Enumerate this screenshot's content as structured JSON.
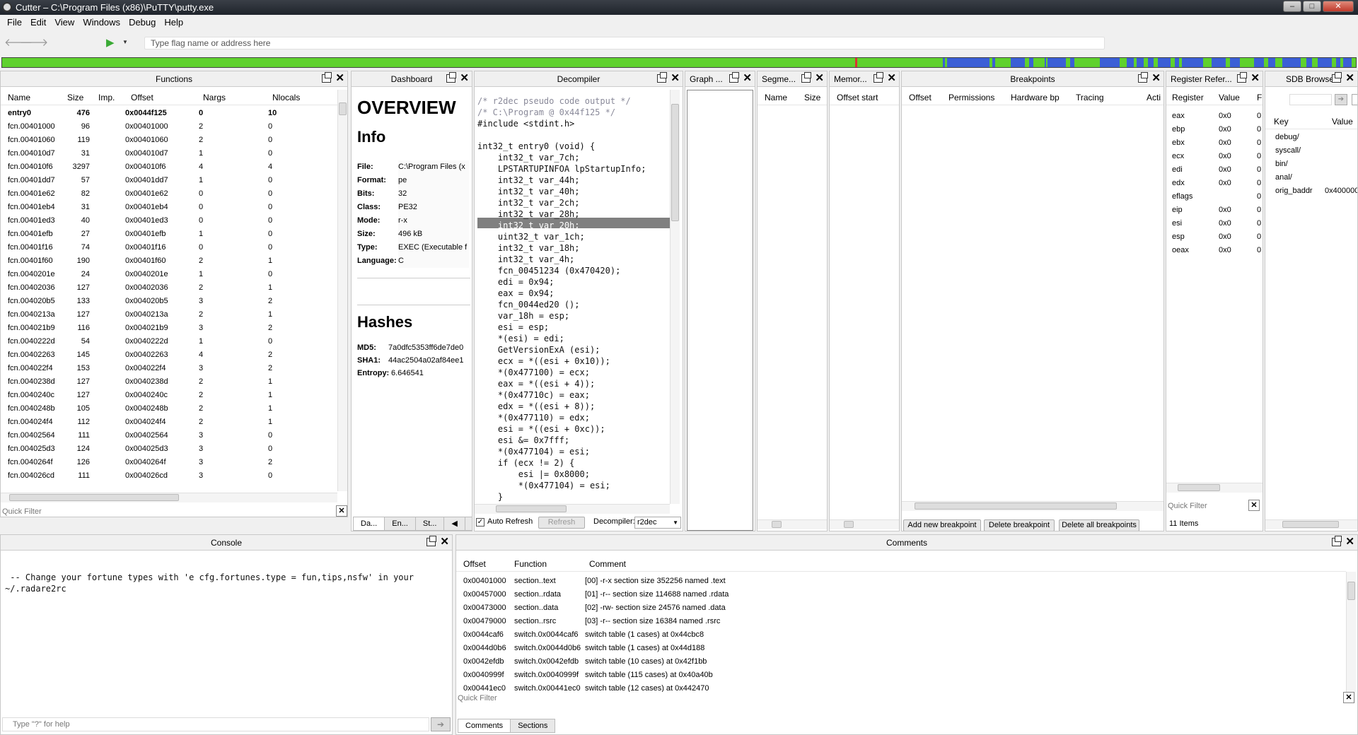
{
  "window": {
    "title": "Cutter – C:\\Program Files (x86)\\PuTTY\\putty.exe"
  },
  "menu": [
    "File",
    "Edit",
    "View",
    "Windows",
    "Debug",
    "Help"
  ],
  "toolbar": {
    "search_placeholder": "Type flag name or address here",
    "back_icon": "arrow-left-icon",
    "forward_icon": "arrow-right-icon",
    "play_icon": "play-icon"
  },
  "functions": {
    "title": "Functions",
    "columns": [
      "Name",
      "Size",
      "Imp.",
      "Offset",
      "Nargs",
      "Nlocals"
    ],
    "rows": [
      [
        "entry0",
        "476",
        "",
        "0x0044f125",
        "0",
        "10"
      ],
      [
        "fcn.00401000",
        "96",
        "",
        "0x00401000",
        "2",
        "0"
      ],
      [
        "fcn.00401060",
        "119",
        "",
        "0x00401060",
        "2",
        "0"
      ],
      [
        "fcn.004010d7",
        "31",
        "",
        "0x004010d7",
        "1",
        "0"
      ],
      [
        "fcn.004010f6",
        "3297",
        "",
        "0x004010f6",
        "4",
        "4"
      ],
      [
        "fcn.00401dd7",
        "57",
        "",
        "0x00401dd7",
        "1",
        "0"
      ],
      [
        "fcn.00401e62",
        "82",
        "",
        "0x00401e62",
        "0",
        "0"
      ],
      [
        "fcn.00401eb4",
        "31",
        "",
        "0x00401eb4",
        "0",
        "0"
      ],
      [
        "fcn.00401ed3",
        "40",
        "",
        "0x00401ed3",
        "0",
        "0"
      ],
      [
        "fcn.00401efb",
        "27",
        "",
        "0x00401efb",
        "1",
        "0"
      ],
      [
        "fcn.00401f16",
        "74",
        "",
        "0x00401f16",
        "0",
        "0"
      ],
      [
        "fcn.00401f60",
        "190",
        "",
        "0x00401f60",
        "2",
        "1"
      ],
      [
        "fcn.0040201e",
        "24",
        "",
        "0x0040201e",
        "1",
        "0"
      ],
      [
        "fcn.00402036",
        "127",
        "",
        "0x00402036",
        "2",
        "1"
      ],
      [
        "fcn.004020b5",
        "133",
        "",
        "0x004020b5",
        "3",
        "2"
      ],
      [
        "fcn.0040213a",
        "127",
        "",
        "0x0040213a",
        "2",
        "1"
      ],
      [
        "fcn.004021b9",
        "116",
        "",
        "0x004021b9",
        "3",
        "2"
      ],
      [
        "fcn.0040222d",
        "54",
        "",
        "0x0040222d",
        "1",
        "0"
      ],
      [
        "fcn.00402263",
        "145",
        "",
        "0x00402263",
        "4",
        "2"
      ],
      [
        "fcn.004022f4",
        "153",
        "",
        "0x004022f4",
        "3",
        "2"
      ],
      [
        "fcn.0040238d",
        "127",
        "",
        "0x0040238d",
        "2",
        "1"
      ],
      [
        "fcn.0040240c",
        "127",
        "",
        "0x0040240c",
        "2",
        "1"
      ],
      [
        "fcn.0040248b",
        "105",
        "",
        "0x0040248b",
        "2",
        "1"
      ],
      [
        "fcn.004024f4",
        "112",
        "",
        "0x004024f4",
        "2",
        "1"
      ],
      [
        "fcn.00402564",
        "111",
        "",
        "0x00402564",
        "3",
        "0"
      ],
      [
        "fcn.004025d3",
        "124",
        "",
        "0x004025d3",
        "3",
        "0"
      ],
      [
        "fcn.0040264f",
        "126",
        "",
        "0x0040264f",
        "3",
        "2"
      ],
      [
        "fcn.004026cd",
        "111",
        "",
        "0x004026cd",
        "3",
        "0"
      ]
    ],
    "quick_filter": "Quick Filter"
  },
  "dashboard": {
    "title": "Dashboard",
    "overview": "OVERVIEW",
    "info_heading": "Info",
    "info": [
      [
        "File:",
        "C:\\Program Files (x"
      ],
      [
        "Format:",
        "pe"
      ],
      [
        "Bits:",
        "32"
      ],
      [
        "Class:",
        "PE32"
      ],
      [
        "Mode:",
        "r-x"
      ],
      [
        "Size:",
        "496 kB"
      ],
      [
        "Type:",
        "EXEC (Executable f"
      ],
      [
        "Language:",
        "C"
      ]
    ],
    "hashes_heading": "Hashes",
    "hashes": [
      [
        "MD5:",
        "7a0dfc5353ff6de7de0"
      ],
      [
        "SHA1:",
        "44ac2504a02af84ee1"
      ],
      [
        "Entropy:",
        "6.646541"
      ]
    ],
    "tabs": [
      "Da...",
      "En...",
      "St..."
    ]
  },
  "decompiler": {
    "title": "Decompiler",
    "lines": [
      "/* r2dec pseudo code output */",
      "/* C:\\Program @ 0x44f125 */",
      "#include <stdint.h>",
      "",
      "int32_t entry0 (void) {",
      "    int32_t var_7ch;",
      "    LPSTARTUPINFOA lpStartupInfo;",
      "    int32_t var_44h;",
      "    int32_t var_40h;",
      "    int32_t var_2ch;",
      "    int32_t var_28h;",
      "    int32_t var_20h;",
      "    uint32_t var_1ch;",
      "    int32_t var_18h;",
      "    int32_t var_4h;",
      "    fcn_00451234 (0x470420);",
      "    edi = 0x94;",
      "    eax = 0x94;",
      "    fcn_0044ed20 ();",
      "    var_18h = esp;",
      "    esi = esp;",
      "    *(esi) = edi;",
      "    GetVersionExA (esi);",
      "    ecx = *((esi + 0x10));",
      "    *(0x477100) = ecx;",
      "    eax = *((esi + 4));",
      "    *(0x47710c) = eax;",
      "    edx = *((esi + 8));",
      "    *(0x477110) = edx;",
      "    esi = *((esi + 0xc));",
      "    esi &= 0x7fff;",
      "    *(0x477104) = esi;",
      "    if (ecx != 2) {",
      "        esi |= 0x8000;",
      "        *(0x477104) = esi;",
      "    }"
    ],
    "auto_refresh": "Auto Refresh",
    "refresh": "Refresh",
    "decompiler_label": "Decompiler:",
    "decompiler_value": "r2dec"
  },
  "graph": {
    "title": "Graph ..."
  },
  "segments": {
    "title": "Segme...",
    "columns": [
      "Name",
      "Size"
    ]
  },
  "memory": {
    "title": "Memor...",
    "columns": [
      "Offset start"
    ]
  },
  "breakpoints": {
    "title": "Breakpoints",
    "columns": [
      "Offset",
      "Permissions",
      "Hardware bp",
      "Tracing",
      "Acti"
    ],
    "add": "Add new breakpoint",
    "delete": "Delete breakpoint",
    "delete_all": "Delete all breakpoints"
  },
  "registers": {
    "title": "Register Refer...",
    "columns": [
      "Register",
      "Value",
      "F"
    ],
    "rows": [
      [
        "eax",
        "0x0",
        "0"
      ],
      [
        "ebp",
        "0x0",
        "0"
      ],
      [
        "ebx",
        "0x0",
        "0"
      ],
      [
        "ecx",
        "0x0",
        "0"
      ],
      [
        "edi",
        "0x0",
        "0"
      ],
      [
        "edx",
        "0x0",
        "0"
      ],
      [
        "eflags",
        "",
        "0"
      ],
      [
        "eip",
        "0x0",
        "0"
      ],
      [
        "esi",
        "0x0",
        "0"
      ],
      [
        "esp",
        "0x0",
        "0"
      ],
      [
        "oeax",
        "0x0",
        "0"
      ]
    ],
    "quick_filter": "Quick Filter",
    "count": "11 Items"
  },
  "sdb": {
    "title": "SDB Browser",
    "columns": [
      "Key",
      "Value"
    ],
    "rows": [
      [
        "debug/",
        ""
      ],
      [
        "syscall/",
        ""
      ],
      [
        "bin/",
        ""
      ],
      [
        "anal/",
        ""
      ],
      [
        "orig_baddr",
        "0x400000"
      ]
    ]
  },
  "console": {
    "title": "Console",
    "text": " -- Change your fortune types with 'e cfg.fortunes.type = fun,tips,nsfw' in your\n~/.radare2rc",
    "input_placeholder": "Type \"?\" for help"
  },
  "comments": {
    "title": "Comments",
    "columns": [
      "Offset",
      "Function",
      "Comment"
    ],
    "rows": [
      [
        "0x00401000",
        "section..text",
        "[00] -r-x section size 352256 named .text"
      ],
      [
        "0x00457000",
        "section..rdata",
        "[01] -r-- section size 114688 named .rdata"
      ],
      [
        "0x00473000",
        "section..data",
        "[02] -rw- section size 24576 named .data"
      ],
      [
        "0x00479000",
        "section..rsrc",
        "[03] -r-- section size 16384 named .rsrc"
      ],
      [
        "0x0044caf6",
        "switch.0x0044caf6",
        "switch table (1 cases) at 0x44cbc8"
      ],
      [
        "0x0044d0b6",
        "switch.0x0044d0b6",
        "switch table (1 cases) at 0x44d188"
      ],
      [
        "0x0042efdb",
        "switch.0x0042efdb",
        "switch table (10 cases) at 0x42f1bb"
      ],
      [
        "0x0040999f",
        "switch.0x0040999f",
        "switch table (115 cases) at 0x40a40b"
      ],
      [
        "0x00441ec0",
        "switch.0x00441ec0",
        "switch table (12 cases) at 0x442470"
      ]
    ],
    "quick_filter": "Quick Filter",
    "tabs": [
      "Comments",
      "Sections"
    ]
  },
  "colors": {
    "accent_green": "#5fd12d",
    "map_blue": "#3b5fd6",
    "selection": "#808080"
  }
}
